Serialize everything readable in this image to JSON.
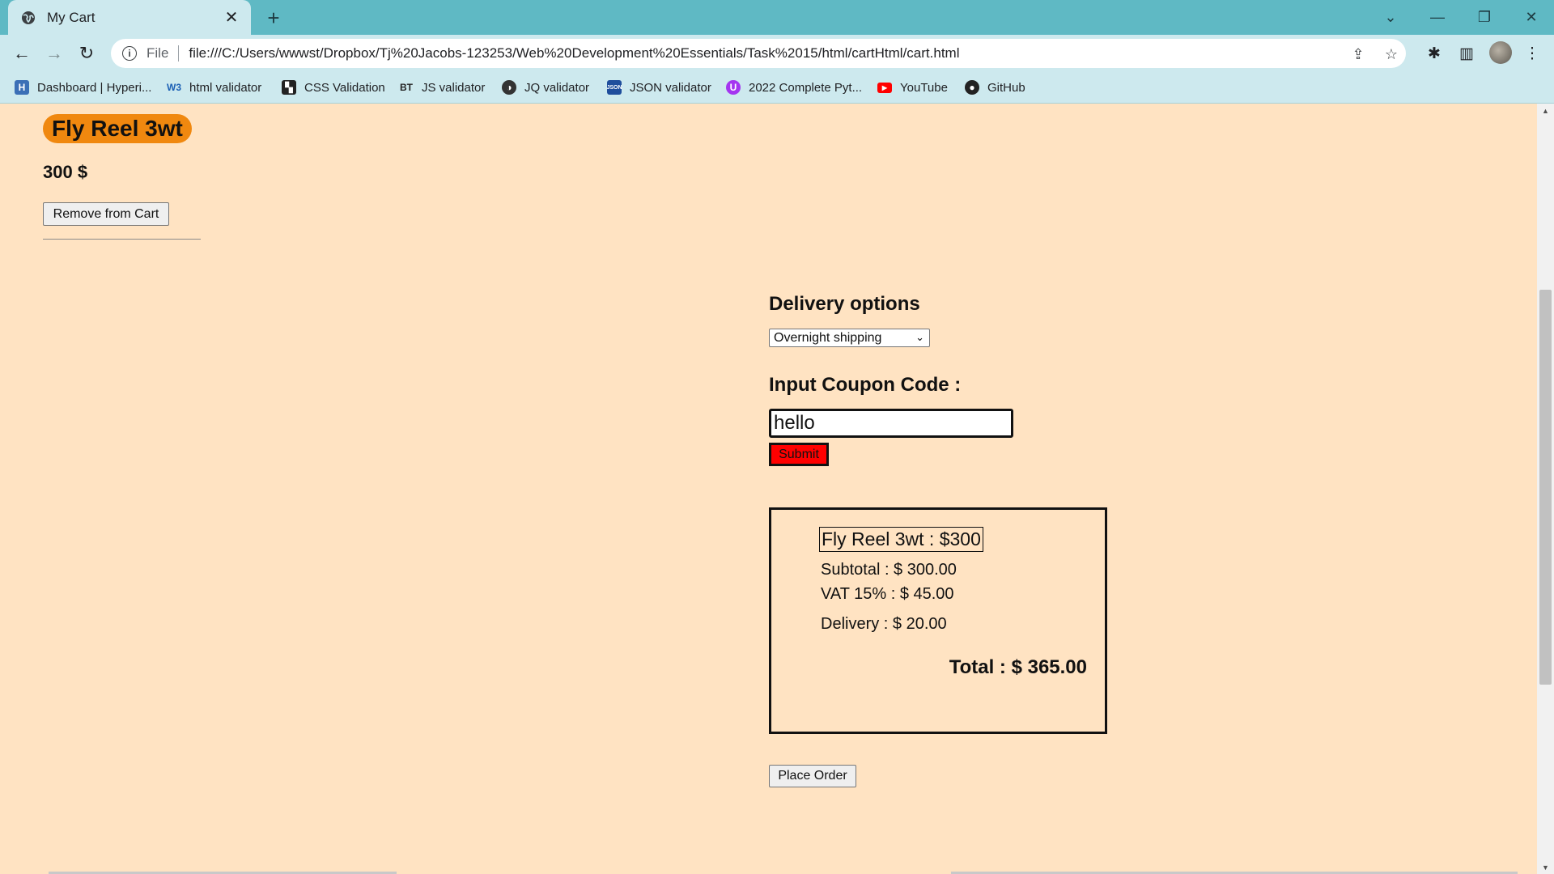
{
  "browser": {
    "tab_title": "My Cart",
    "new_tab_symbol": "+",
    "file_label": "File",
    "url": "file:///C:/Users/wwwst/Dropbox/Tj%20Jacobs-123253/Web%20Development%20Essentials/Task%2015/html/cartHtml/cart.html",
    "bookmarks": [
      {
        "label": "Dashboard | Hyperi...",
        "icon": "hyperion-icon"
      },
      {
        "label": "html validator",
        "icon": "w3c-icon"
      },
      {
        "label": "CSS Validation",
        "icon": "css-validator-icon"
      },
      {
        "label": "JS validator",
        "icon": "bt-icon"
      },
      {
        "label": "JQ validator",
        "icon": "jq-icon"
      },
      {
        "label": "JSON validator",
        "icon": "json-icon"
      },
      {
        "label": "2022 Complete Pyt...",
        "icon": "udemy-icon"
      },
      {
        "label": "YouTube",
        "icon": "youtube-icon"
      },
      {
        "label": "GitHub",
        "icon": "github-icon"
      }
    ]
  },
  "cart": {
    "product_name": "Fly Reel 3wt",
    "product_price": "300 $",
    "remove_label": "Remove from Cart"
  },
  "delivery": {
    "heading": "Delivery options",
    "selected": "Overnight shipping"
  },
  "coupon": {
    "heading": "Input Coupon Code :",
    "value": "hello",
    "submit_label": "Submit"
  },
  "summary": {
    "item": "Fly Reel 3wt : $300",
    "subtotal": "Subtotal : $ 300.00",
    "vat": "VAT 15% : $ 45.00",
    "delivery": "Delivery : $ 20.00",
    "total": "Total : $ 365.00"
  },
  "order": {
    "place_label": "Place Order"
  },
  "colors": {
    "page_bg": "#ffe3c2",
    "product_badge": "#f0880f",
    "submit_bg": "#ff0000",
    "chrome": "#5fb9c4"
  }
}
